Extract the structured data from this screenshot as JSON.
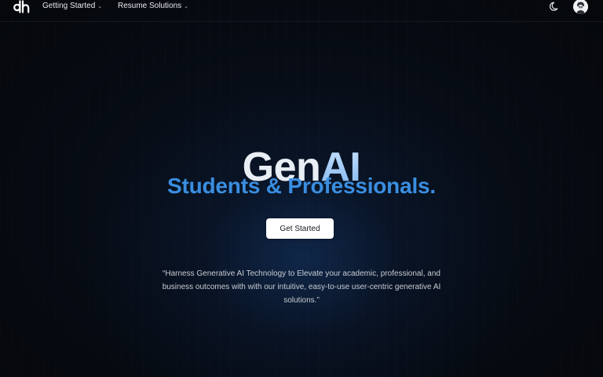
{
  "navbar": {
    "logo_text": "dh",
    "items": [
      {
        "label": "Getting Started",
        "chevron": "⌄"
      },
      {
        "label": "Resume Solutions",
        "chevron": "⌄"
      }
    ],
    "theme_icon": "moon-icon",
    "avatar_icon": "user-avatar"
  },
  "hero": {
    "title_part1": "Gen",
    "title_part2": "AI",
    "subtitle": "Students & Professionals.",
    "cta_label": "Get Started",
    "quote": "“Harness Generative AI Technology to Elevate your academic, professional, and business outcomes with with our intuitive, easy-to-use user-centric generative AI solutions.”"
  },
  "colors": {
    "background": "#05070b",
    "subtitle_blue": "#3a8ee0",
    "title_white": "#e9eef5",
    "button_bg": "#ffffff"
  }
}
